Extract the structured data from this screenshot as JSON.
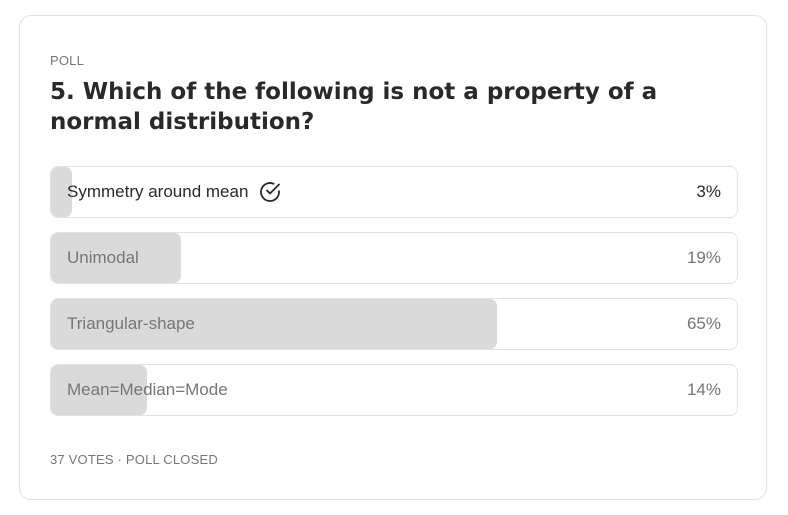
{
  "poll": {
    "kicker": "POLL",
    "question": "5. Which of the following is not a property of a normal distribution?",
    "options": [
      {
        "label": "Symmetry around mean",
        "percent_text": "3%",
        "percent": 3,
        "selected": true
      },
      {
        "label": "Unimodal",
        "percent_text": "19%",
        "percent": 19,
        "selected": false
      },
      {
        "label": "Triangular-shape",
        "percent_text": "65%",
        "percent": 65,
        "selected": false
      },
      {
        "label": "Mean=Median=Mode",
        "percent_text": "14%",
        "percent": 14,
        "selected": false
      }
    ],
    "footer": "37 VOTES · POLL CLOSED"
  },
  "icons": {
    "selected_icon": "check-circle-icon"
  },
  "colors": {
    "fill": "#dadada",
    "text_primary": "#292929",
    "text_secondary": "#767676",
    "border": "#e3e3e3"
  }
}
